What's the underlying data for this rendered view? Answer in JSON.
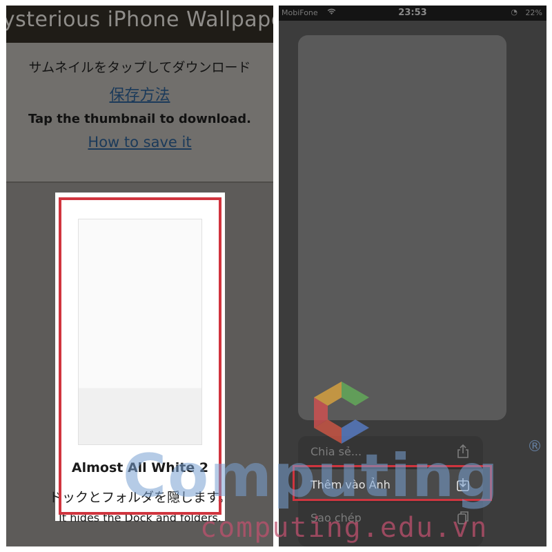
{
  "left_panel": {
    "site_title": "lysterious iPhone Wallpape",
    "jp_instruction": "サムネイルをタップしてダウンロード",
    "jp_save_link": "保存方法",
    "en_instruction": "Tap the thumbnail to download.",
    "en_save_link": "How to save it",
    "wallpaper": {
      "title": "Almost All White 2",
      "desc_jp": "ドックとフォルダを隠します。",
      "desc_en": "It hides the Dock and folders."
    }
  },
  "right_panel": {
    "status_bar": {
      "carrier": "MobiFone",
      "time": "23:53",
      "battery": "22%"
    },
    "share_menu": {
      "items": [
        {
          "label": "Chia sẻ...",
          "icon": "share-icon"
        },
        {
          "label": "Thêm vào Ảnh",
          "icon": "save-to-photos-icon"
        },
        {
          "label": "Sao chép",
          "icon": "copy-icon"
        }
      ]
    }
  },
  "watermark": {
    "brand": "Computing",
    "url": "computing.edu.vn",
    "registered_mark": "®"
  },
  "colors": {
    "highlight": "#d0343e",
    "dim_overlay": "#5d5b59"
  }
}
